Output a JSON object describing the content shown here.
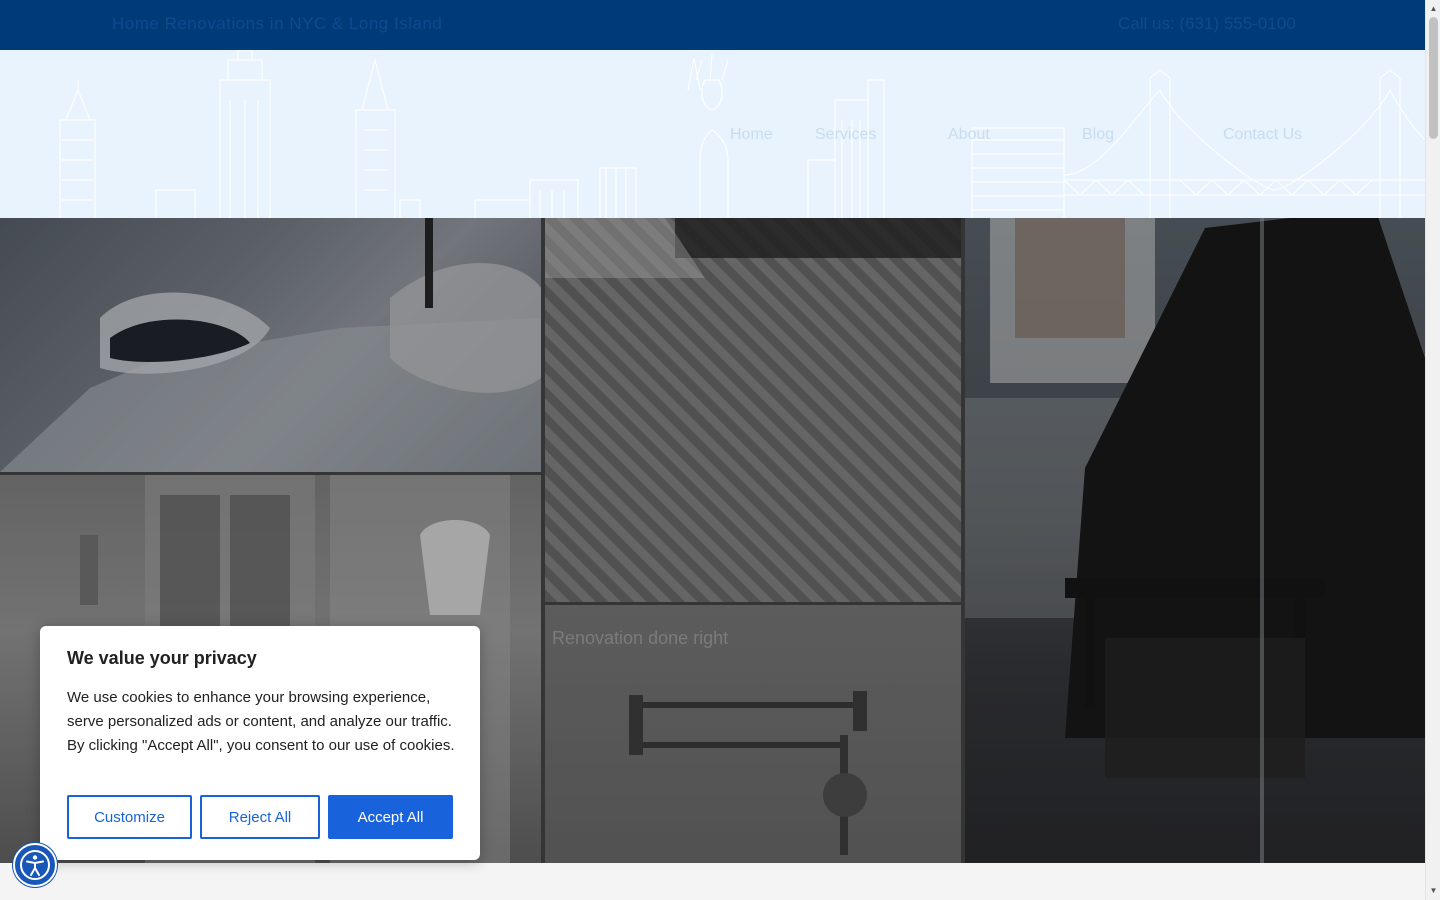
{
  "topbar": {
    "left_text": "Home Renovations in NYC & Long Island",
    "right_text": "Call us: (631) 555-0100"
  },
  "nav": {
    "items": [
      "Home",
      "Services",
      "About",
      "Blog",
      "Contact Us"
    ]
  },
  "hero": {
    "caption": "Renovation done right"
  },
  "cookie": {
    "title": "We value your privacy",
    "body": "We use cookies to enhance your browsing experience, serve personalized ads or content, and analyze our traffic. By clicking \"Accept All\", you consent to our use of cookies.",
    "customize_label": "Customize",
    "reject_label": "Reject All",
    "accept_label": "Accept All"
  },
  "colors": {
    "topbar": "#003a77",
    "header_bg": "#e8f3fd",
    "primary_button": "#1863dc",
    "accessibility_button": "#1856b8"
  },
  "icons": {
    "accessibility": "accessibility-icon",
    "scroll_up": "scroll-up-arrow-icon",
    "scroll_down": "scroll-down-arrow-icon"
  }
}
